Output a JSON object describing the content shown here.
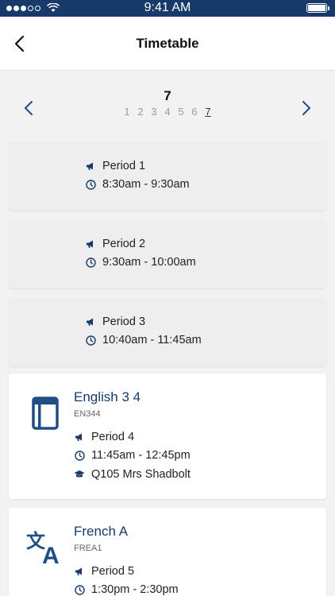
{
  "status_bar": {
    "time": "9:41 AM",
    "signal_filled": 3,
    "signal_total": 5
  },
  "header": {
    "title": "Timetable",
    "back_icon": "chevron-left-icon"
  },
  "day_pager": {
    "current_day": "7",
    "days": [
      "1",
      "2",
      "3",
      "4",
      "5",
      "6",
      "7"
    ],
    "active_day": "7",
    "prev_icon": "chevron-left-icon",
    "next_icon": "chevron-right-icon"
  },
  "free_periods": [
    {
      "period": "Period 1",
      "time": "8:30am - 9:30am"
    },
    {
      "period": "Period 2",
      "time": "9:30am - 10:00am"
    },
    {
      "period": "Period 3",
      "time": "10:40am - 11:45am"
    }
  ],
  "classes": [
    {
      "name": "English 3 4",
      "code": "EN344",
      "period": "Period 4",
      "time": "11:45am - 12:45pm",
      "room_teacher": "Q105 Mrs Shadbolt",
      "icon": "book-icon"
    },
    {
      "name": "French A",
      "code": "FREA1",
      "period": "Period 5",
      "time": "1:30pm - 2:30pm",
      "icon": "translate-icon"
    }
  ],
  "colors": {
    "brand": "#183a6a",
    "accent": "#1f4f86"
  }
}
